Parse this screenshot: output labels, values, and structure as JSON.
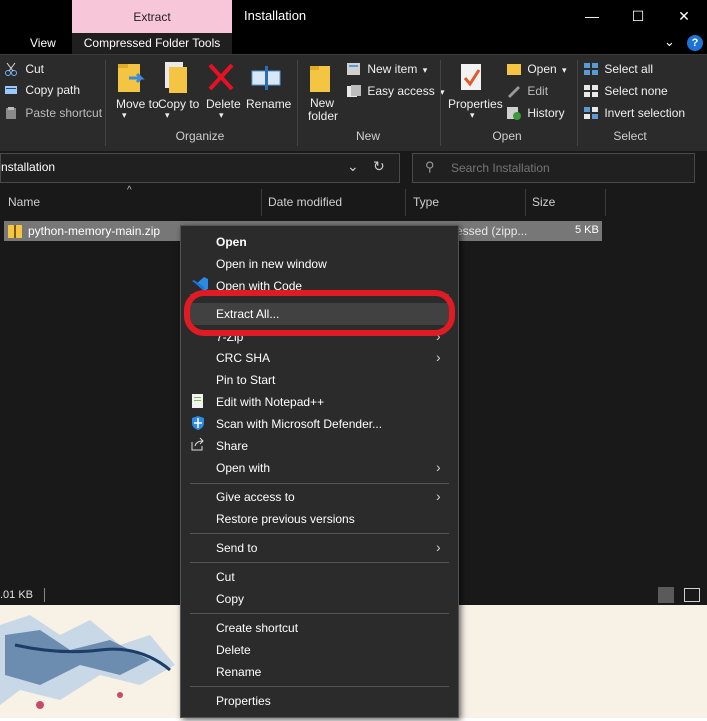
{
  "titlebar": {
    "context_tab": "Extract",
    "title": "Installation",
    "minimize": "—",
    "maximize": "☐",
    "close": "✕"
  },
  "tabs": {
    "view": "View",
    "compressed_folder_tools": "Compressed Folder Tools",
    "collapse": "⌄",
    "help": "?"
  },
  "ribbon": {
    "clipboard": {
      "cut": "Cut",
      "copy_path": "Copy path",
      "paste_shortcut": "Paste shortcut"
    },
    "organize": {
      "label": "Organize",
      "move_to": "Move to",
      "copy_to": "Copy to",
      "delete": "Delete",
      "rename": "Rename"
    },
    "new": {
      "label": "New",
      "new_folder": "New folder",
      "new_item": "New item",
      "easy_access": "Easy access"
    },
    "open": {
      "label": "Open",
      "properties": "Properties",
      "open": "Open",
      "edit": "Edit",
      "history": "History"
    },
    "select": {
      "label": "Select",
      "select_all": "Select all",
      "select_none": "Select none",
      "invert_selection": "Invert selection"
    }
  },
  "address": {
    "path": "nstallation",
    "search_placeholder": "Search Installation"
  },
  "columns": {
    "name": "Name",
    "date_modified": "Date modified",
    "type": "Type",
    "size": "Size"
  },
  "file": {
    "name": "python-memory-main.zip",
    "type_fragment": "ressed (zipp...",
    "size": "5 KB"
  },
  "status": {
    "size": ".01 KB"
  },
  "context_menu": {
    "open": "Open",
    "open_new_window": "Open in new window",
    "open_with_code": "Open with Code",
    "extract_all": "Extract All...",
    "seven_zip": "7-Zip",
    "crc_sha": "CRC SHA",
    "pin_to_start": "Pin to Start",
    "edit_notepad": "Edit with Notepad++",
    "scan_defender": "Scan with Microsoft Defender...",
    "share": "Share",
    "open_with": "Open with",
    "give_access": "Give access to",
    "restore_versions": "Restore previous versions",
    "send_to": "Send to",
    "cut": "Cut",
    "copy": "Copy",
    "create_shortcut": "Create shortcut",
    "delete": "Delete",
    "rename": "Rename",
    "properties": "Properties"
  },
  "colors": {
    "accent": "#f7c6d9",
    "highlight_ring": "#e01b24",
    "menu_bg": "#2b2b2b"
  }
}
